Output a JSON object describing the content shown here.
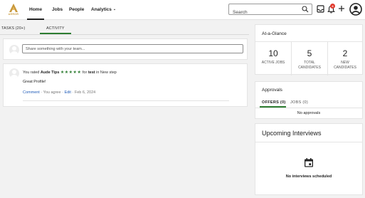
{
  "brand": {
    "logo_text": "AEROR",
    "accent": "#c8983a"
  },
  "nav": {
    "items": [
      {
        "label": "Home"
      },
      {
        "label": "Jobs"
      },
      {
        "label": "People"
      },
      {
        "label": "Analytics"
      }
    ],
    "active": "Home"
  },
  "search": {
    "placeholder": "Search",
    "icon": "search-icon"
  },
  "topbar_icons": {
    "inbox": "inbox-icon",
    "notifications": "bell-icon",
    "notification_count": "4",
    "add": "plus-icon",
    "profile": "user-avatar-icon"
  },
  "feed": {
    "tabs": [
      {
        "label": "TASKS (20+)"
      },
      {
        "label": "ACTIVITY"
      }
    ],
    "active_tab": "ACTIVITY",
    "composer_placeholder": "Share something with your team...",
    "activity": {
      "prefix": "You rated",
      "subject": "Aude Tips",
      "stars": "★★★★★",
      "for_text": "for",
      "job": "test",
      "step_text": "in New step",
      "comment": "Great Profile!",
      "actions": {
        "comment": "Comment",
        "sep": "·",
        "agree": "You agree",
        "edit": "Edit",
        "date": "Feb 6, 2024"
      }
    }
  },
  "glance": {
    "title": "At-a-Glance",
    "stats": [
      {
        "value": "10",
        "label": "ACTIVE JOBS"
      },
      {
        "value": "5",
        "label": "TOTAL CANDIDATES"
      },
      {
        "value": "2",
        "label": "NEW CANDIDATES"
      }
    ]
  },
  "approvals": {
    "title": "Approvals",
    "tabs": [
      {
        "label": "OFFERS (0)"
      },
      {
        "label": "JOBS (0)"
      }
    ],
    "active_tab": "OFFERS (0)",
    "empty": "No approvals"
  },
  "interviews": {
    "title": "Upcoming Interviews",
    "icon": "calendar-icon",
    "empty": "No interviews scheduled"
  },
  "colors": {
    "green": "#2e7d32",
    "link": "#1f5bb8",
    "badge": "#e23b2e"
  }
}
